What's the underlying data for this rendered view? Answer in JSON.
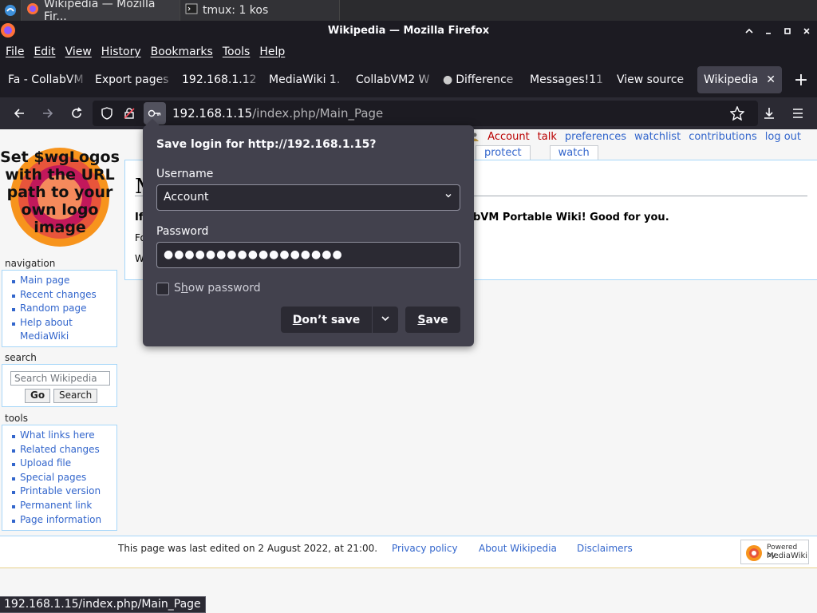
{
  "taskbar": {
    "items": [
      {
        "label": "Wikipedia — Mozilla Fir..."
      },
      {
        "label": "tmux: 1 kos"
      }
    ]
  },
  "window": {
    "title": "Wikipedia — Mozilla Firefox"
  },
  "menubar": {
    "items": [
      "File",
      "Edit",
      "View",
      "History",
      "Bookmarks",
      "Tools",
      "Help"
    ]
  },
  "tabs": [
    {
      "label": "Fa - CollabVM"
    },
    {
      "label": "Export pages"
    },
    {
      "label": "192.168.1.12"
    },
    {
      "label": "MediaWiki 1."
    },
    {
      "label": "CollabVM2 W"
    },
    {
      "label": "Difference"
    },
    {
      "label": "Messages!11"
    },
    {
      "label": "View source"
    },
    {
      "label": "Wikipedia"
    }
  ],
  "urlbar": {
    "host": "192.168.1.15",
    "path": "/index.php/Main_Page"
  },
  "page": {
    "logo_text": "Set $wgLogos with the URL path to your own logo image",
    "personal": {
      "account": "Account",
      "talk": "talk",
      "preferences": "preferences",
      "watchlist": "watchlist",
      "contributions": "contributions",
      "logout": "log out"
    },
    "page_tabs": {
      "protect": "protect",
      "watch": "watch"
    },
    "content": {
      "heading_partial": "M",
      "line1_partial": "If",
      "line1_end": "bVM Portable Wiki! Good for you.",
      "line2_partial": "Fo",
      "line3_partial": "W"
    },
    "navigation": {
      "heading": "navigation",
      "items": [
        "Main page",
        "Recent changes",
        "Random page",
        "Help about",
        "MediaWiki"
      ]
    },
    "search": {
      "heading": "search",
      "placeholder": "Search Wikipedia",
      "go": "Go",
      "search": "Search"
    },
    "tools": {
      "heading": "tools",
      "items": [
        "What links here",
        "Related changes",
        "Upload file",
        "Special pages",
        "Printable version",
        "Permanent link",
        "Page information"
      ]
    },
    "footer": {
      "last_modified": "This page was last edited on 2 August 2022, at 21:00.",
      "privacy": "Privacy policy",
      "about": "About Wikipedia",
      "disclaimers": "Disclaimers",
      "powered_1": "Powered by",
      "powered_2": "MediaWiki"
    }
  },
  "status_bar": "192.168.1.15/index.php/Main_Page",
  "password_dialog": {
    "title": "Save login for http://192.168.1.15?",
    "username_label": "Username",
    "username_value": "Account",
    "password_label": "Password",
    "password_value": "●●●●●●●●●●●●●●●●●",
    "show_password_prefix": "S",
    "show_password_u": "h",
    "show_password_rest": "ow password",
    "dont_save_u": "D",
    "dont_save_rest": "on’t save",
    "save_u": "S",
    "save_rest": "ave"
  }
}
